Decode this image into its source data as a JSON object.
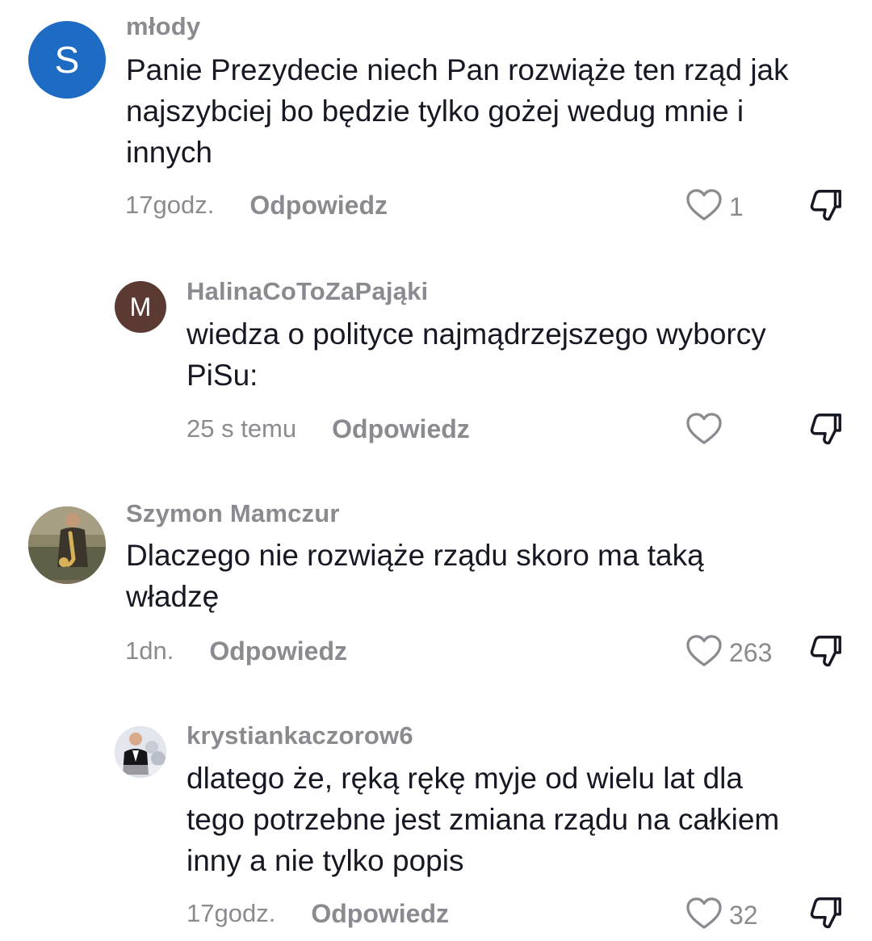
{
  "comments": [
    {
      "avatar_letter": "S",
      "avatar_color": "#1e6bc4",
      "username": "młody",
      "text": "Panie Prezydecie niech Pan rozwiąże ten rząd jak\nnajszybciej bo będzie tylko gożej wedug mnie i\ninnych",
      "time": "17godz.",
      "reply": "Odpowiedz",
      "likes": "1"
    },
    {
      "avatar_letter": "M",
      "avatar_color": "#5a3a32",
      "username": "HalinaCoToZaPająki",
      "text": "wiedza o polityce najmądrzejszego wyborcy\nPiSu:",
      "time": "25 s temu",
      "reply": "Odpowiedz",
      "likes": ""
    },
    {
      "avatar_icon": "saxophone-player-photo",
      "username": "Szymon Mamczur",
      "text": "Dlaczego nie rozwiąże rządu skoro ma taką\nwładzę",
      "time": "1dn.",
      "reply": "Odpowiedz",
      "likes": "263"
    },
    {
      "avatar_icon": "person-in-suit-photo",
      "username": "krystiankaczorow6",
      "text": "dlatego że, ręką rękę myje od wielu lat dla\ntego potrzebne jest zmiana rządu na całkiem\ninny a nie tylko popis",
      "time": "17godz.",
      "reply": "Odpowiedz",
      "likes": "32"
    }
  ],
  "colors": {
    "muted": "#8a8b91",
    "text": "#161823"
  }
}
